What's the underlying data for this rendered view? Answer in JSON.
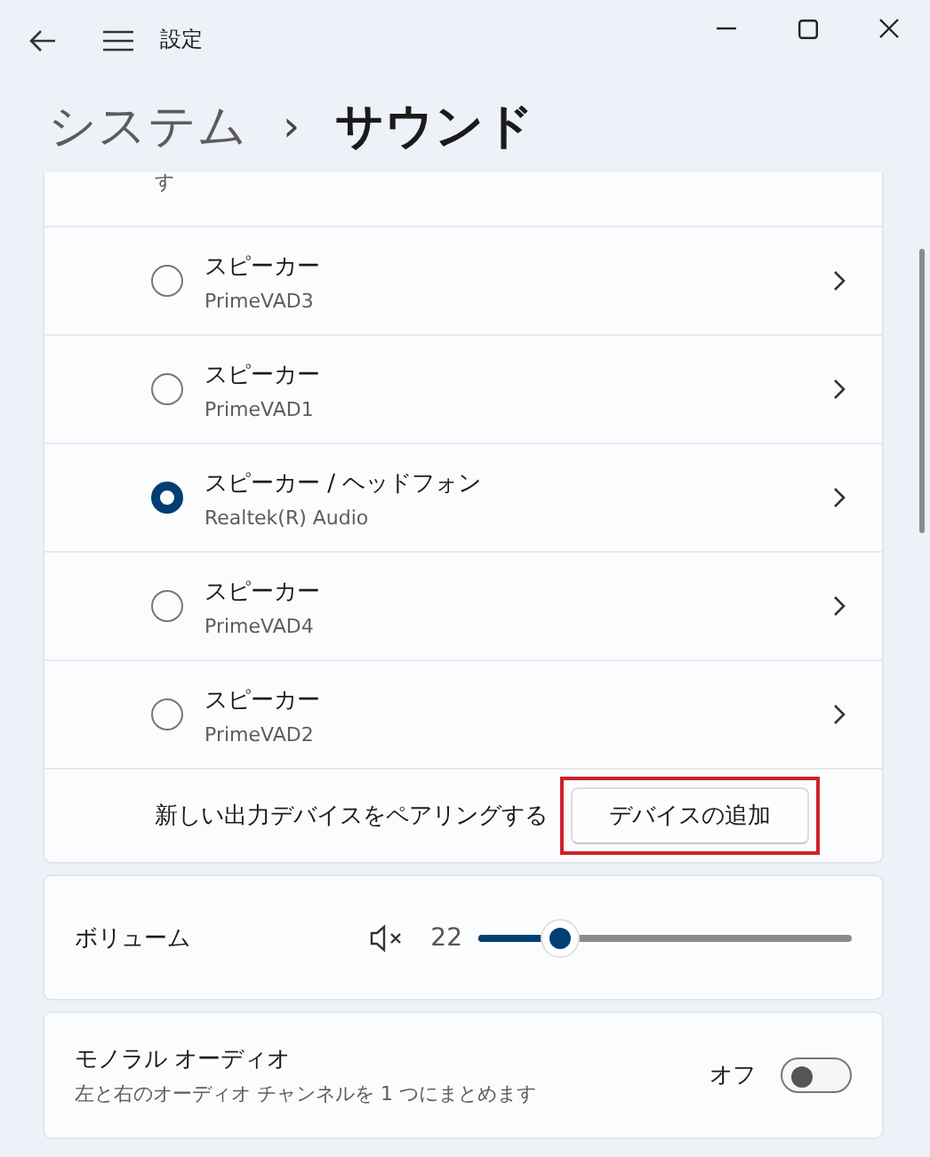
{
  "window": {
    "title": "設定"
  },
  "breadcrumb": {
    "parent": "システム",
    "separator": "›",
    "current": "サウンド"
  },
  "output_devices": {
    "cut_text": "す",
    "devices": [
      {
        "name": "スピーカー",
        "detail": "PrimeVAD3",
        "selected": false
      },
      {
        "name": "スピーカー",
        "detail": "PrimeVAD1",
        "selected": false
      },
      {
        "name": "スピーカー / ヘッドフォン",
        "detail": "Realtek(R) Audio",
        "selected": true
      },
      {
        "name": "スピーカー",
        "detail": "PrimeVAD4",
        "selected": false
      },
      {
        "name": "スピーカー",
        "detail": "PrimeVAD2",
        "selected": false
      }
    ],
    "pair_label": "新しい出力デバイスをペアリングする",
    "add_button": {
      "label": "デバイスの追加",
      "highlighted": true
    }
  },
  "volume": {
    "label": "ボリューム",
    "muted": true,
    "reading": "22",
    "level": 0.22
  },
  "mono_audio": {
    "title": "モノラル オーディオ",
    "description": "左と右のオーディオ チャンネルを 1 つにまとめます",
    "state_label": "オフ",
    "on": false
  }
}
